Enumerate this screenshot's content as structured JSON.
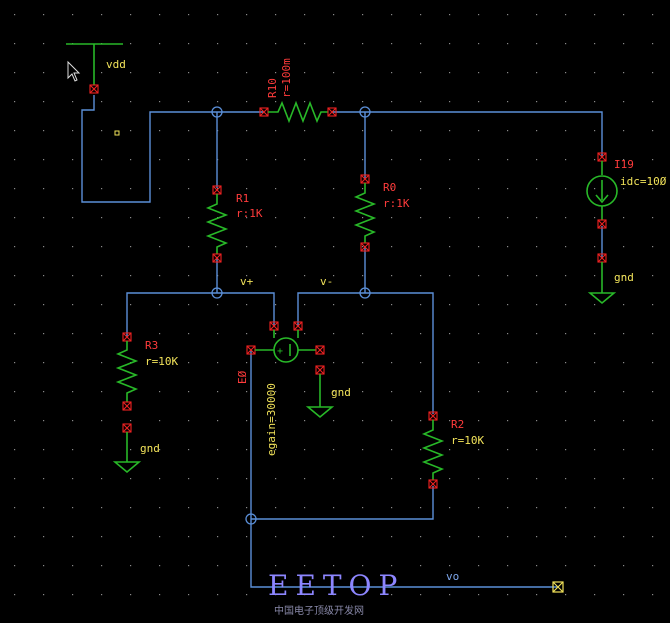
{
  "labels": {
    "vdd": "vdd",
    "r10_name": "R10",
    "r10_value": "r=100m",
    "r1_name": "R1",
    "r1_value": "r:1K",
    "r0_name": "R0",
    "r0_value": "r:1K",
    "i19_name": "I19",
    "i19_value": "idc=10Ø",
    "gnd_i19": "gnd",
    "vplus": "v+",
    "vminus": "v-",
    "r3_name": "R3",
    "r3_value": "r=10K",
    "gnd_r3": "gnd",
    "e0_name": "EØ",
    "egain": "egain=30000",
    "gnd_e0": "gnd",
    "r2_name": "R2",
    "r2_value": "r=10K",
    "vo": "vo"
  },
  "watermark": {
    "title": "EETOP",
    "subtitle": "中国电子顶级开发网"
  },
  "colors": {
    "background": "#000000",
    "wire": "#5b8fd8",
    "component": "#28b828",
    "pin": "#e22222",
    "label_red": "#ff3b3b",
    "label_yellow": "#f2e35a",
    "watermark": "#8d86ff"
  }
}
